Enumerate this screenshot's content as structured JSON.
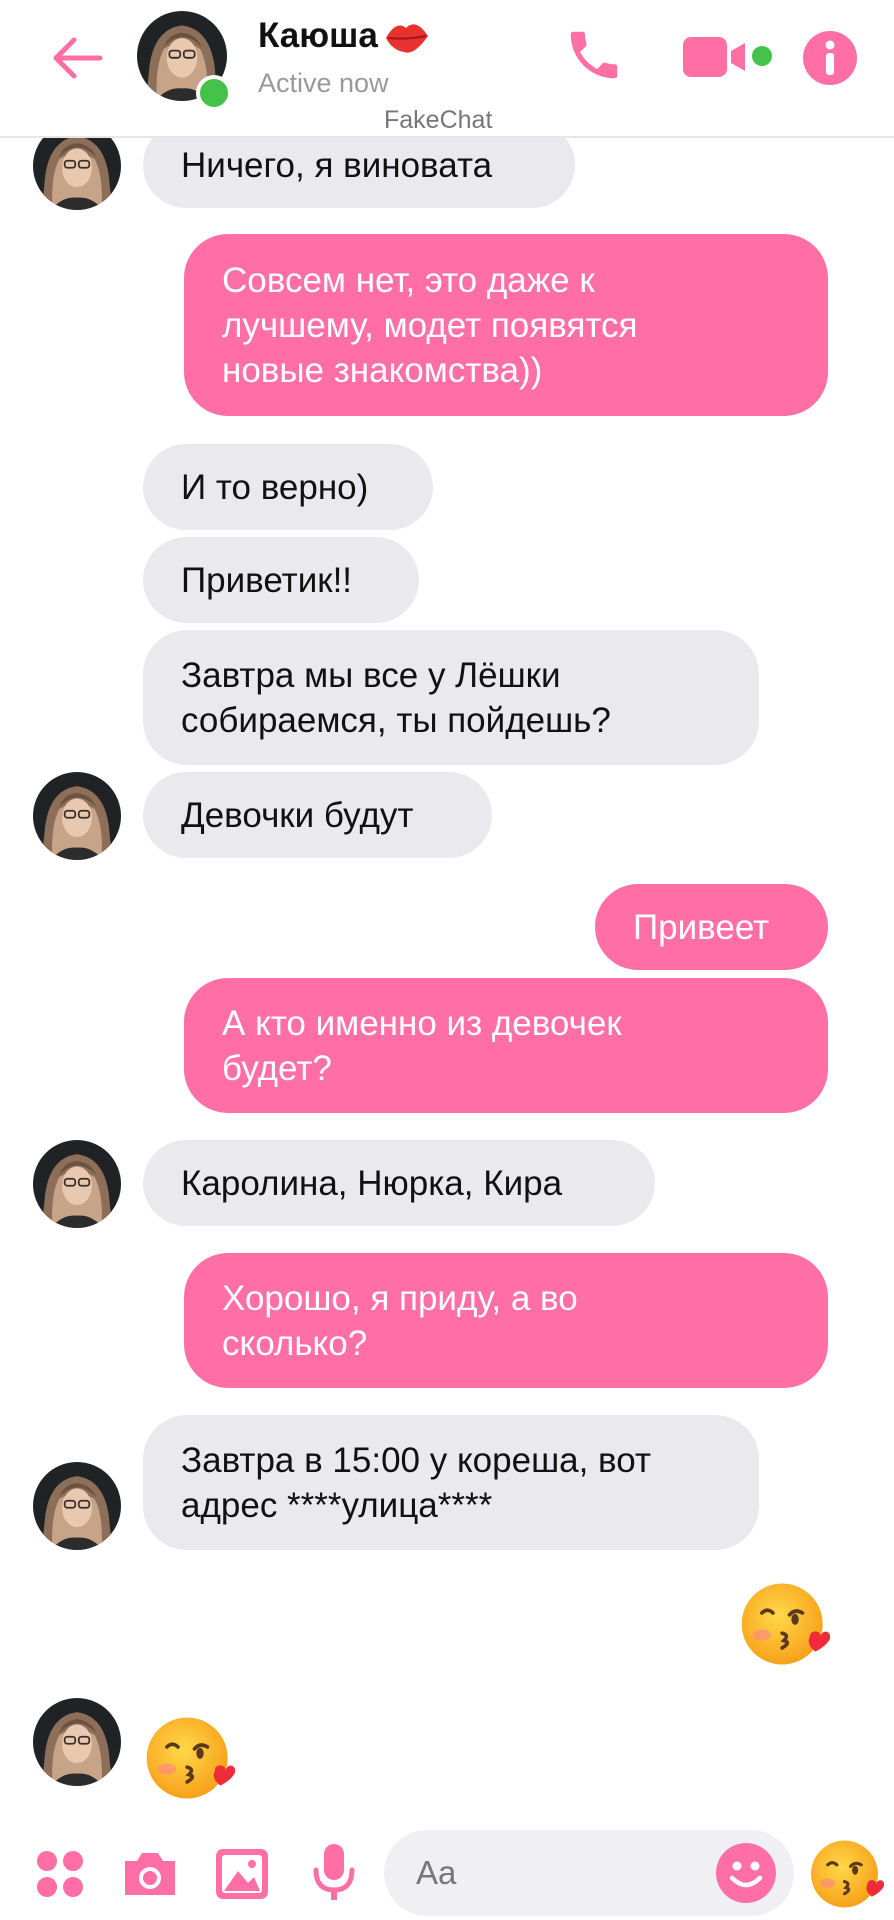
{
  "header": {
    "contact_name": "Каюша",
    "status": "Active now",
    "watermark": "FakeChat"
  },
  "colors": {
    "accent": "#ff6fa5",
    "incoming_bubble": "#eae9ee",
    "online": "#44c24a"
  },
  "icons": [
    "back-arrow-icon",
    "lips-icon",
    "phone-icon",
    "video-camera-icon",
    "info-icon",
    "apps-grid-icon",
    "camera-icon",
    "gallery-icon",
    "microphone-icon",
    "smiley-icon",
    "kissing-emoji-icon"
  ],
  "messages": [
    {
      "from": "contact",
      "text": "Ничего, я виновата"
    },
    {
      "from": "me",
      "lines": [
        "Совсем нет, это даже к",
        "лучшему, модет появятся",
        "новые знакомства))"
      ]
    },
    {
      "from": "contact",
      "text": "И то верно)"
    },
    {
      "from": "contact",
      "text": "Приветик!!"
    },
    {
      "from": "contact",
      "lines": [
        "Завтра мы все у Лёшки",
        "собираемся, ты пойдешь?"
      ]
    },
    {
      "from": "contact",
      "text": "Девочки будут"
    },
    {
      "from": "me",
      "text": "Привеет"
    },
    {
      "from": "me",
      "lines": [
        "А кто именно из девочек",
        "будет?"
      ]
    },
    {
      "from": "contact",
      "text": "Каролина, Нюрка, Кира"
    },
    {
      "from": "me",
      "lines": [
        "Хорошо, я приду, а во",
        "сколько?"
      ]
    },
    {
      "from": "contact",
      "lines": [
        "Завтра в 15:00 у кореша, вот",
        "адрес ****улица****"
      ]
    },
    {
      "from": "me",
      "emoji": "kissing-emoji"
    },
    {
      "from": "contact",
      "emoji": "kissing-emoji"
    }
  ],
  "composer": {
    "placeholder": "Aa"
  }
}
